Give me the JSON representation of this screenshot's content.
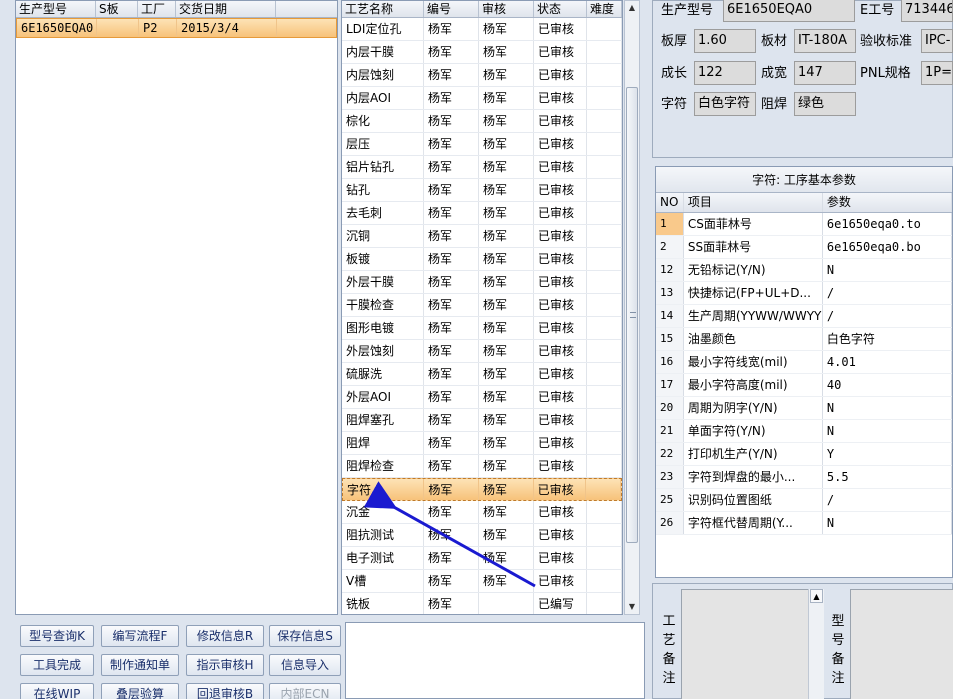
{
  "orders": {
    "columns": [
      "生产型号",
      "S板",
      "工厂",
      "交货日期"
    ],
    "rows": [
      {
        "model": "6E1650EQA0",
        "s": "",
        "factory": "P2",
        "date": "2015/3/4"
      }
    ]
  },
  "process": {
    "columns": [
      "工艺名称",
      "编号",
      "审核",
      "状态",
      "难度"
    ],
    "rows": [
      {
        "name": "LDI定位孔",
        "code": "杨军",
        "audit": "杨军",
        "status": "已审核"
      },
      {
        "name": "内层干膜",
        "code": "杨军",
        "audit": "杨军",
        "status": "已审核"
      },
      {
        "name": "内层蚀刻",
        "code": "杨军",
        "audit": "杨军",
        "status": "已审核"
      },
      {
        "name": "内层AOI",
        "code": "杨军",
        "audit": "杨军",
        "status": "已审核"
      },
      {
        "name": "棕化",
        "code": "杨军",
        "audit": "杨军",
        "status": "已审核"
      },
      {
        "name": "层压",
        "code": "杨军",
        "audit": "杨军",
        "status": "已审核"
      },
      {
        "name": "铝片钻孔",
        "code": "杨军",
        "audit": "杨军",
        "status": "已审核"
      },
      {
        "name": "钻孔",
        "code": "杨军",
        "audit": "杨军",
        "status": "已审核"
      },
      {
        "name": "去毛刺",
        "code": "杨军",
        "audit": "杨军",
        "status": "已审核"
      },
      {
        "name": "沉铜",
        "code": "杨军",
        "audit": "杨军",
        "status": "已审核"
      },
      {
        "name": "板镀",
        "code": "杨军",
        "audit": "杨军",
        "status": "已审核"
      },
      {
        "name": "外层干膜",
        "code": "杨军",
        "audit": "杨军",
        "status": "已审核"
      },
      {
        "name": "干膜检查",
        "code": "杨军",
        "audit": "杨军",
        "status": "已审核"
      },
      {
        "name": "图形电镀",
        "code": "杨军",
        "audit": "杨军",
        "status": "已审核"
      },
      {
        "name": "外层蚀刻",
        "code": "杨军",
        "audit": "杨军",
        "status": "已审核"
      },
      {
        "name": "硫脲洗",
        "code": "杨军",
        "audit": "杨军",
        "status": "已审核"
      },
      {
        "name": "外层AOI",
        "code": "杨军",
        "audit": "杨军",
        "status": "已审核"
      },
      {
        "name": "阻焊塞孔",
        "code": "杨军",
        "audit": "杨军",
        "status": "已审核"
      },
      {
        "name": "阻焊",
        "code": "杨军",
        "audit": "杨军",
        "status": "已审核"
      },
      {
        "name": "阻焊检查",
        "code": "杨军",
        "audit": "杨军",
        "status": "已审核"
      },
      {
        "name": "字符",
        "code": "杨军",
        "audit": "杨军",
        "status": "已审核",
        "selected": true
      },
      {
        "name": "沉金",
        "code": "杨军",
        "audit": "杨军",
        "status": "已审核"
      },
      {
        "name": "阻抗测试",
        "code": "杨军",
        "audit": "杨军",
        "status": "已审核"
      },
      {
        "name": "电子测试",
        "code": "杨军",
        "audit": "杨军",
        "status": "已审核"
      },
      {
        "name": "V槽",
        "code": "杨军",
        "audit": "杨军",
        "status": "已审核"
      },
      {
        "name": "铣板",
        "code": "杨军",
        "audit": "",
        "status": "已编写"
      }
    ]
  },
  "buttons": {
    "model_query": "型号查询K",
    "edit_flow": "编写流程F",
    "modify_info": "修改信息R",
    "save_info": "保存信息S",
    "tool_done": "工具完成",
    "make_notice": "制作通知单",
    "assign_audit": "指示审核H",
    "import_info": "信息导入",
    "online_wip": "在线WIP",
    "stack_check": "叠层验算",
    "return_audit": "回退审核B",
    "internal_ecn": "内部ECN"
  },
  "header": {
    "model_label": "生产型号",
    "model_value": "6E1650EQA0",
    "eno_label": "E工号",
    "eno_value": "713446",
    "thickness_label": "板厚",
    "thickness_value": "1.60",
    "material_label": "板材",
    "material_value": "IT-180A",
    "standard_label": "验收标准",
    "standard_value": "IPC-",
    "length_label": "成长",
    "length_value": "122",
    "width_label": "成宽",
    "width_value": "147",
    "pnl_label": "PNL规格",
    "pnl_value": "1P=",
    "char_label": "字符",
    "char_value": "白色字符",
    "mask_label": "阻焊",
    "mask_value": "绿色"
  },
  "params": {
    "title": "字符: 工序基本参数",
    "columns": [
      "NO",
      "项目",
      "参数"
    ],
    "rows": [
      {
        "no": "1",
        "item": "CS面菲林号",
        "value": "6e1650eqa0.to",
        "selected": true
      },
      {
        "no": "2",
        "item": "SS面菲林号",
        "value": "6e1650eqa0.bo"
      },
      {
        "no": "12",
        "item": "无铅标记(Y/N)",
        "value": "N"
      },
      {
        "no": "13",
        "item": "快捷标记(FP+UL+D...",
        "value": "/"
      },
      {
        "no": "14",
        "item": "生产周期(YYWW/WWYY)",
        "value": "/"
      },
      {
        "no": "15",
        "item": "油墨颜色",
        "value": "白色字符"
      },
      {
        "no": "16",
        "item": "最小字符线宽(mil)",
        "value": "4.01"
      },
      {
        "no": "17",
        "item": "最小字符高度(mil)",
        "value": "40"
      },
      {
        "no": "20",
        "item": "周期为阴字(Y/N)",
        "value": "N"
      },
      {
        "no": "21",
        "item": "单面字符(Y/N)",
        "value": "N"
      },
      {
        "no": "22",
        "item": "打印机生产(Y/N)",
        "value": "Y"
      },
      {
        "no": "23",
        "item": "字符到焊盘的最小...",
        "value": "5.5"
      },
      {
        "no": "25",
        "item": "识别码位置图纸",
        "value": "/"
      },
      {
        "no": "26",
        "item": "字符框代替周期(Y...",
        "value": "N"
      }
    ]
  },
  "remarks": {
    "process_label": [
      "工",
      "艺",
      "备",
      "注"
    ],
    "model_label": [
      "型",
      "号",
      "备",
      "注"
    ]
  },
  "colors": {
    "selection": "#f7c27a",
    "arrow": "#1a1ad0"
  }
}
